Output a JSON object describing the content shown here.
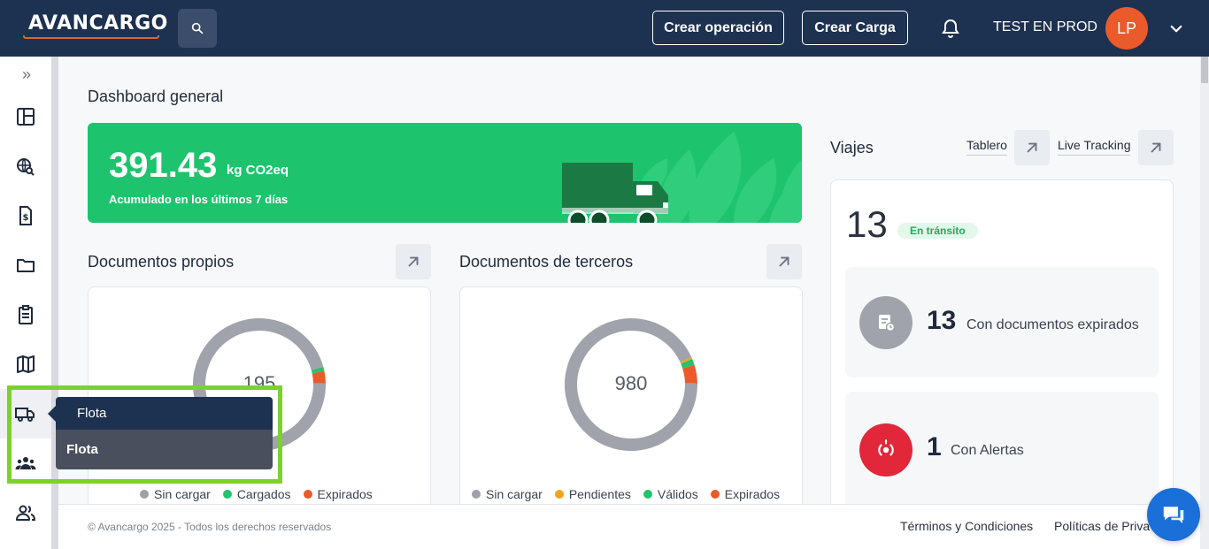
{
  "header": {
    "logo_text": "AVANCARGO",
    "create_operation_label": "Crear operación",
    "create_load_label": "Crear Carga",
    "username": "TEST EN PROD",
    "avatar_initials": "LP"
  },
  "sidebar": {
    "expand_icon": "»",
    "tooltip_label": "Flota",
    "submenu_label": "Flota"
  },
  "dashboard": {
    "title": "Dashboard general",
    "co2": {
      "value": "391.43",
      "unit": "kg CO2eq",
      "subtitle": "Acumulado en los últimos 7 días"
    },
    "own_docs": {
      "title": "Documentos propios",
      "total": "195",
      "legend": [
        "Sin cargar",
        "Cargados",
        "Expirados"
      ]
    },
    "third_docs": {
      "title": "Documentos de terceros",
      "total": "980",
      "legend": [
        "Sin cargar",
        "Pendientes",
        "Válidos",
        "Expirados"
      ]
    },
    "trips": {
      "title": "Viajes",
      "board_link": "Tablero",
      "tracking_link": "Live Tracking",
      "in_transit_count": "13",
      "in_transit_label": "En tránsito",
      "expired_docs_count": "13",
      "expired_docs_label": "Con documentos expirados",
      "alerts_count": "1",
      "alerts_label": "Con Alertas"
    }
  },
  "chart_data": [
    {
      "type": "pie",
      "title": "Documentos propios",
      "center_label": "195",
      "categories": [
        "Sin cargar",
        "Cargados",
        "Expirados"
      ],
      "values": [
        96,
        1,
        3
      ],
      "colors": [
        "#a0a3ab",
        "#22c46b",
        "#ea5a2b"
      ]
    },
    {
      "type": "pie",
      "title": "Documentos de terceros",
      "center_label": "980",
      "categories": [
        "Sin cargar",
        "Pendientes",
        "Válidos",
        "Expirados"
      ],
      "values": [
        93.5,
        0.5,
        1.5,
        4.5
      ],
      "colors": [
        "#a0a3ab",
        "#f2a31c",
        "#22c46b",
        "#ea5a2b"
      ]
    }
  ],
  "footer": {
    "copyright": "© Avancargo 2025 - Todos los derechos reservados",
    "terms": "Términos y Condiciones",
    "privacy": "Políticas de Priva"
  },
  "colors": {
    "header_bg": "#1d3150",
    "accent_orange": "#ea5a2b",
    "green": "#1dc46d",
    "highlight": "#7dd12e",
    "alert_red": "#e2273a",
    "chat_blue": "#1a6fd8"
  },
  "icons": {
    "search": "search-icon",
    "bell": "bell-icon",
    "chevron": "chevron-down-icon",
    "chat": "chat-icon"
  }
}
